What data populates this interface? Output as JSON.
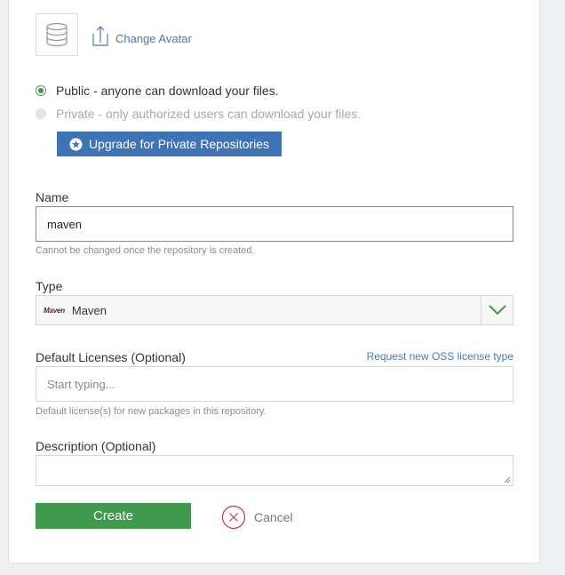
{
  "avatar": {
    "change_label": "Change Avatar"
  },
  "visibility": {
    "public_label": "Public - anyone can download your files.",
    "private_label": "Private - only authorized users can download your files.",
    "selected": "public",
    "upgrade_label": "Upgrade for Private Repositories"
  },
  "name": {
    "label": "Name",
    "value": "maven",
    "hint": "Cannot be changed once the repository is created."
  },
  "type": {
    "label": "Type",
    "logo_text": "Maven",
    "value": "Maven"
  },
  "licenses": {
    "label": "Default Licenses (Optional)",
    "request_link": "Request new OSS license type",
    "placeholder": "Start typing...",
    "hint": "Default license(s) for new packages in this repository."
  },
  "description": {
    "label": "Description (Optional)",
    "value": ""
  },
  "actions": {
    "create_label": "Create",
    "cancel_label": "Cancel"
  },
  "colors": {
    "primary_blue": "#3e73b5",
    "create_green": "#3f9a4d",
    "cancel_red": "#c9393a"
  },
  "icons": {
    "avatar": "database-icon",
    "change_avatar": "upload-icon",
    "upgrade": "star-icon",
    "select_caret": "chevron-down-icon",
    "cancel": "close-circle-icon"
  }
}
